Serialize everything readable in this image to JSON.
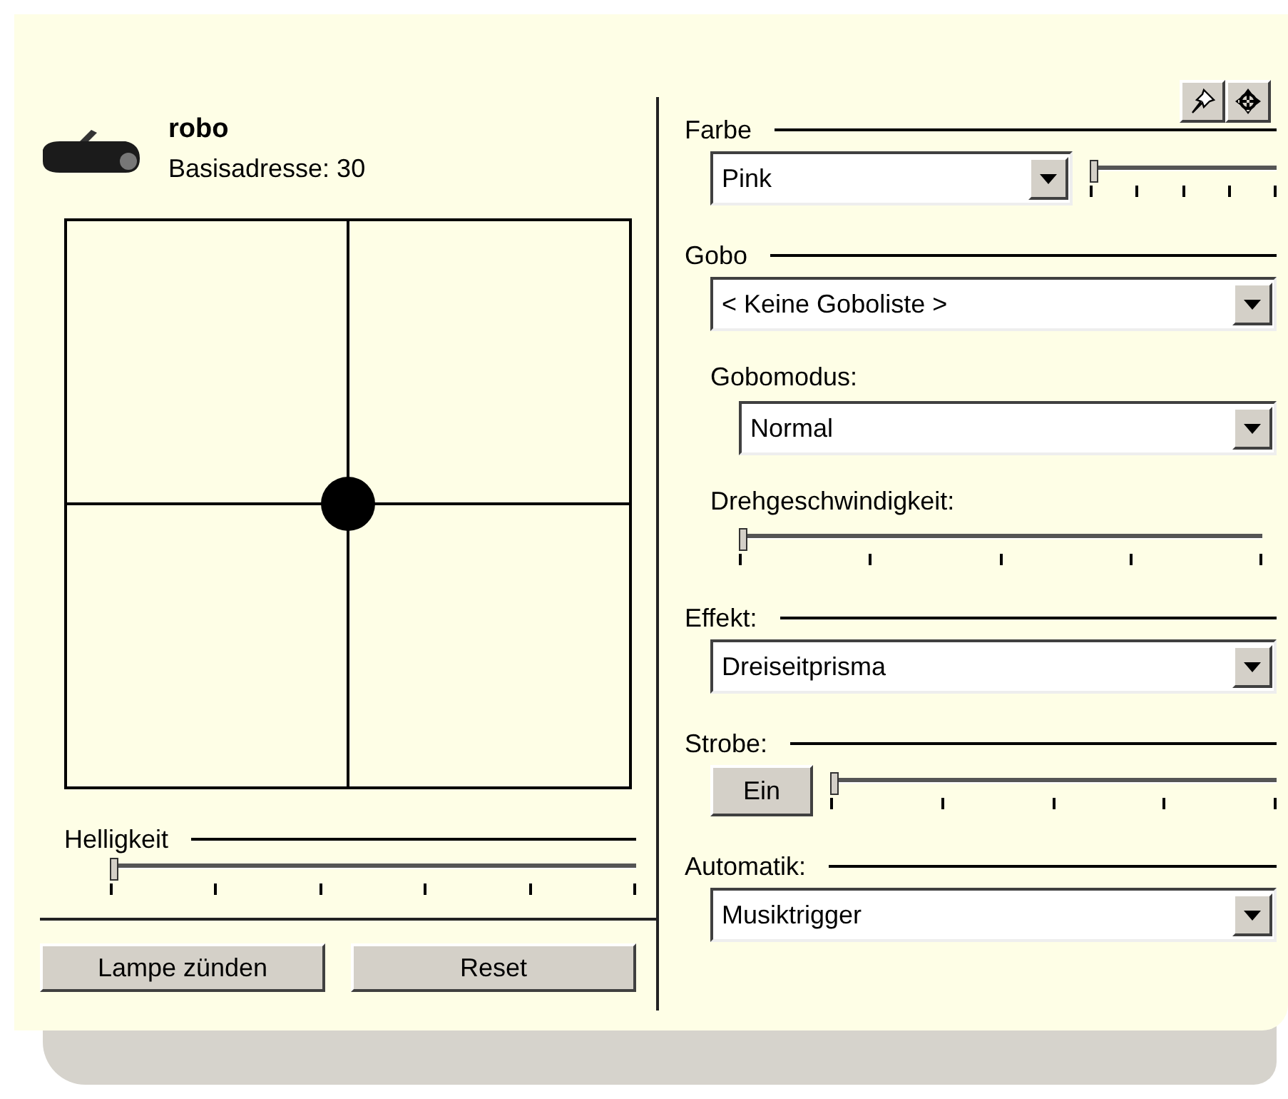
{
  "device": {
    "name": "robo",
    "address": "Basisadresse: 30"
  },
  "position_pad": {
    "pan": {
      "level": 0.5
    },
    "tilt": {
      "level": 0.5
    }
  },
  "brightness": {
    "label": "Helligkeit",
    "level": 0
  },
  "buttons": [
    "Lampe zünden",
    "Reset"
  ],
  "color": {
    "label": "Farbe",
    "value": "Pink",
    "level": 0
  },
  "gobo": {
    "label": "Gobo",
    "value": "< Keine Goboliste >",
    "mode_label": "Gobomodus:",
    "mode_value": "Normal",
    "speed_label": "Drehgeschwindigkeit:",
    "speed_level": {
      "level": 0
    }
  },
  "effect": {
    "label": "Effekt:",
    "value": "Dreiseitprisma"
  },
  "strobe": {
    "label": "Strobe:",
    "button": "Ein",
    "level": 0
  },
  "automatic": {
    "label": "Automatik:",
    "value": "Musiktrigger"
  }
}
